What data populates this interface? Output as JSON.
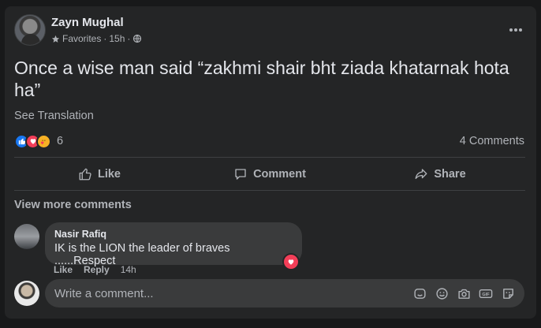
{
  "post": {
    "author": "Zayn Mughal",
    "audience": "Favorites",
    "time": "15h",
    "separator": "·",
    "text": "Once a wise man said “zakhmi shair bht ziada khatarnak hota ha”",
    "see_translation": "See Translation",
    "reaction_count": "6",
    "comments_count": "4 Comments"
  },
  "actions": {
    "like": "Like",
    "comment": "Comment",
    "share": "Share"
  },
  "comments": {
    "view_more": "View more comments",
    "items": [
      {
        "author": "Nasir Rafiq",
        "text": "IK is the LION the leader of braves ......Respect",
        "like": "Like",
        "reply": "Reply",
        "time": "14h"
      }
    ]
  },
  "composer": {
    "placeholder": "Write a comment..."
  },
  "colors": {
    "background": "#18191a",
    "card": "#242526",
    "bubble": "#3a3b3c",
    "text_primary": "#e4e6eb",
    "text_secondary": "#b0b3b8",
    "like_blue": "#1877f2",
    "love_red": "#f33e58",
    "care_yellow": "#f7b125"
  }
}
